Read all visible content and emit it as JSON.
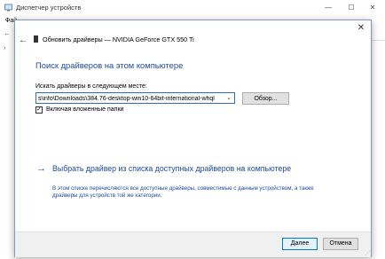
{
  "background_window": {
    "title": "Диспетчер устройств",
    "menu_file": "Фай",
    "minimize": "—",
    "maximize": "☐",
    "close": "✕",
    "back_icon": "arrow-left-icon",
    "tree_arrow": "›"
  },
  "dialog": {
    "close": "✕",
    "back": "←",
    "header_title": "Обновить драйверы — NVIDIA GeForce GTX 550 Ti",
    "section_title": "Поиск драйверов на этом компьютере",
    "search_label": "Искать драйверы в следующем месте:",
    "path_value": "s\\info\\Downloads\\384.76-desktop-win10-64bit-international-whql",
    "browse_label": "Обзор...",
    "include_subfolders_label": "Включая вложенные папки",
    "include_subfolders_checked": true,
    "pick_arrow": "→",
    "pick_title": "Выбрать драйвер из списка доступных драйверов на компьютере",
    "pick_description": "В этом списке перечисляются все доступные драйверы, совместимые с данным устройством, а также драйверы для устройств той же категории.",
    "next_label": "Далее",
    "cancel_label": "Отмена"
  },
  "colors": {
    "link_blue": "#1e4ba5",
    "focus_blue": "#0078d7"
  }
}
